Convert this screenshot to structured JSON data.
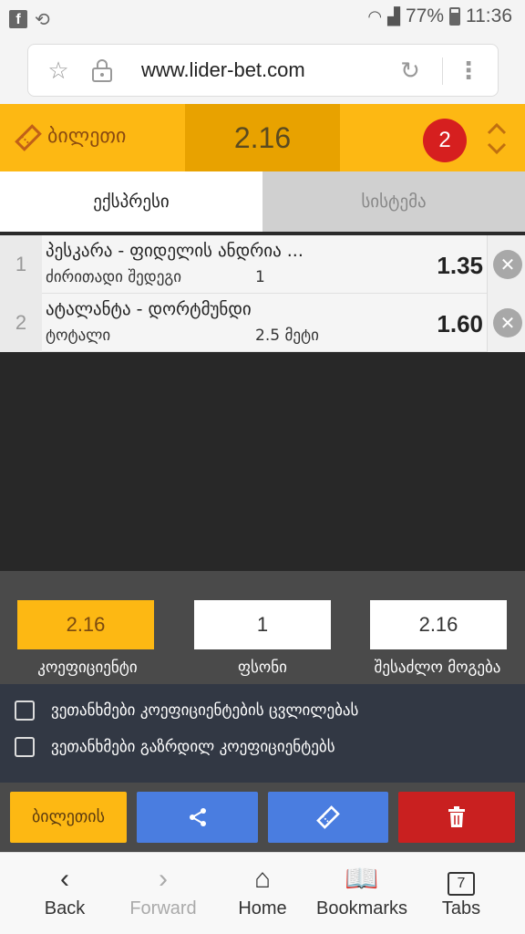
{
  "status_bar": {
    "battery": "77%",
    "time": "11:36",
    "icons": [
      "facebook-icon",
      "sync-icon",
      "wifi-icon",
      "signal-icon",
      "battery-icon"
    ]
  },
  "browser": {
    "url": "www.lider-bet.com"
  },
  "ticket": {
    "title": "ბილეთი",
    "total_odds": "2.16",
    "bet_count": "2"
  },
  "tabs": {
    "express": "ექსპრესი",
    "system": "სისტემა"
  },
  "bets": [
    {
      "num": "1",
      "match": "პესკარა - ფიდელის ანდრია ...",
      "market": "ძირითადი შედეგი",
      "pick": "1",
      "odds": "1.35"
    },
    {
      "num": "2",
      "match": "ატალანტა - დორტმუნდი",
      "market": "ტოტალი",
      "pick": "2.5 მეტი",
      "odds": "1.60"
    }
  ],
  "stake": {
    "coefficient_value": "2.16",
    "stake_value": "1",
    "payout_value": "2.16",
    "coefficient_label": "კოეფიციენტი",
    "stake_label": "ფსონი",
    "payout_label": "შესაძლო მოგება"
  },
  "options": {
    "accept_odds_changes": "ვეთანხმები კოეფიციენტების ცვლილებას",
    "accept_higher_odds": "ვეთანხმები გაზრდილ კოეფიციენტებს"
  },
  "actions": {
    "save_label": "ბილეთის"
  },
  "nav": {
    "back": "Back",
    "forward": "Forward",
    "home": "Home",
    "bookmarks": "Bookmarks",
    "tabs": "Tabs",
    "tab_count": "7"
  },
  "colors": {
    "accent": "#fdb813",
    "accent_dark": "#e8a200",
    "badge": "#d61f1f",
    "blue": "#4a7de0",
    "delete": "#c92020"
  }
}
